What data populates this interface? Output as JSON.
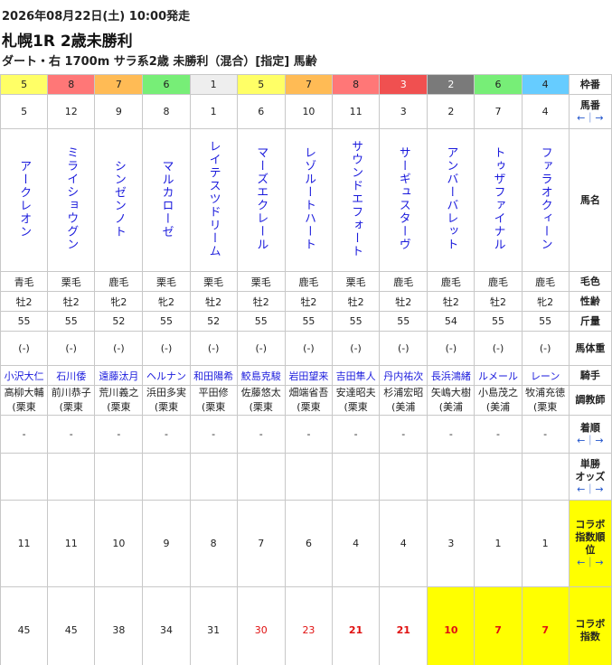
{
  "race": {
    "date_line": "2026年08月22日(土) 10:00発走",
    "title": "札幌1R 2歳未勝利",
    "info": "ダート・右 1700m サラ系2歳 未勝利（混合）[指定] 馬齢"
  },
  "labels": {
    "waku": "枠番",
    "umaban": "馬番",
    "umaban_sort": "←｜→",
    "name": "馬名",
    "coat": "毛色",
    "sex_age": "性齢",
    "weight": "斤量",
    "body_weight": "馬体重",
    "jockey": "騎手",
    "trainer": "調教師",
    "finish": "着順",
    "finish_sort": "←｜→",
    "odds_line1": "単勝",
    "odds_line2": "オッズ",
    "odds_sort": "←｜→",
    "collab_rank_l1": "コラボ",
    "collab_rank_l2": "指数順",
    "collab_rank_l3": "位",
    "collab_rank_sort": "←｜→",
    "collab_index_l1": "コラボ",
    "collab_index_l2": "指数"
  },
  "colors": {
    "waku": {
      "1": "#eeeeee",
      "2": "#7a7a7a",
      "3": "#f05050",
      "4": "#66ccff",
      "5": "#ffff66",
      "6": "#77ee77",
      "7": "#ffbb55",
      "8": "#ff7777"
    },
    "label_bg": "#ffffff",
    "highlight": "#ffff00",
    "name_blue": "#1a1adc",
    "index_red": "#e01010"
  },
  "horses": [
    {
      "waku": "5",
      "umaban": "5",
      "name": "アークレオン",
      "coat": "青毛",
      "sex_age": "牡2",
      "weight": "55",
      "body_weight": "(-)",
      "jockey": "小沢大仁",
      "trainer_name": "高柳大輔",
      "trainer_area": "(栗東",
      "finish": "-",
      "odds": "",
      "collab_rank": "11",
      "collab_index": "45",
      "idx_style": "",
      "idx_bg": ""
    },
    {
      "waku": "8",
      "umaban": "12",
      "name": "ミライショウグン",
      "coat": "栗毛",
      "sex_age": "牡2",
      "weight": "55",
      "body_weight": "(-)",
      "jockey": "石川倭",
      "trainer_name": "前川恭子",
      "trainer_area": "(栗東",
      "finish": "-",
      "odds": "",
      "collab_rank": "11",
      "collab_index": "45",
      "idx_style": "",
      "idx_bg": ""
    },
    {
      "waku": "7",
      "umaban": "9",
      "name": "シンゼンノト",
      "coat": "鹿毛",
      "sex_age": "牝2",
      "weight": "52",
      "body_weight": "(-)",
      "jockey": "遠藤汰月",
      "trainer_name": "荒川義之",
      "trainer_area": "(栗東",
      "finish": "-",
      "odds": "",
      "collab_rank": "10",
      "collab_index": "38",
      "idx_style": "",
      "idx_bg": ""
    },
    {
      "waku": "6",
      "umaban": "8",
      "name": "マルカローゼ",
      "coat": "栗毛",
      "sex_age": "牝2",
      "weight": "55",
      "body_weight": "(-)",
      "jockey": "ヘルナン",
      "trainer_name": "浜田多実",
      "trainer_area": "(栗東",
      "finish": "-",
      "odds": "",
      "collab_rank": "9",
      "collab_index": "34",
      "idx_style": "",
      "idx_bg": ""
    },
    {
      "waku": "1",
      "umaban": "1",
      "name": "レイテスツドリーム",
      "coat": "栗毛",
      "sex_age": "牡2",
      "weight": "52",
      "body_weight": "(-)",
      "jockey": "和田陽希",
      "trainer_name": "平田修",
      "trainer_area": "(栗東",
      "finish": "-",
      "odds": "",
      "collab_rank": "8",
      "collab_index": "31",
      "idx_style": "",
      "idx_bg": ""
    },
    {
      "waku": "5",
      "umaban": "6",
      "name": "マーズエクレール",
      "coat": "栗毛",
      "sex_age": "牡2",
      "weight": "55",
      "body_weight": "(-)",
      "jockey": "鮫島克駿",
      "trainer_name": "佐藤悠太",
      "trainer_area": "(栗東",
      "finish": "-",
      "odds": "",
      "collab_rank": "7",
      "collab_index": "30",
      "idx_style": "red",
      "idx_bg": ""
    },
    {
      "waku": "7",
      "umaban": "10",
      "name": "レゾルートハート",
      "coat": "鹿毛",
      "sex_age": "牡2",
      "weight": "55",
      "body_weight": "(-)",
      "jockey": "岩田望来",
      "trainer_name": "畑端省吾",
      "trainer_area": "(栗東",
      "finish": "-",
      "odds": "",
      "collab_rank": "6",
      "collab_index": "23",
      "idx_style": "red",
      "idx_bg": ""
    },
    {
      "waku": "8",
      "umaban": "11",
      "name": "サウンドエフォート",
      "coat": "栗毛",
      "sex_age": "牡2",
      "weight": "55",
      "body_weight": "(-)",
      "jockey": "吉田隼人",
      "trainer_name": "安達昭夫",
      "trainer_area": "(栗東",
      "finish": "-",
      "odds": "",
      "collab_rank": "4",
      "collab_index": "21",
      "idx_style": "redb",
      "idx_bg": ""
    },
    {
      "waku": "3",
      "umaban": "3",
      "name": "サーギュスターヴ",
      "coat": "鹿毛",
      "sex_age": "牡2",
      "weight": "55",
      "body_weight": "(-)",
      "jockey": "丹内祐次",
      "trainer_name": "杉浦宏昭",
      "trainer_area": "(美浦",
      "finish": "-",
      "odds": "",
      "collab_rank": "4",
      "collab_index": "21",
      "idx_style": "redb",
      "idx_bg": ""
    },
    {
      "waku": "2",
      "umaban": "2",
      "name": "アンバーバレット",
      "coat": "鹿毛",
      "sex_age": "牡2",
      "weight": "54",
      "body_weight": "(-)",
      "jockey": "長浜鴻緒",
      "trainer_name": "矢嶋大樹",
      "trainer_area": "(美浦",
      "finish": "-",
      "odds": "",
      "collab_rank": "3",
      "collab_index": "10",
      "idx_style": "redb",
      "idx_bg": "#ffff00"
    },
    {
      "waku": "6",
      "umaban": "7",
      "name": "トゥザファイナル",
      "coat": "鹿毛",
      "sex_age": "牡2",
      "weight": "55",
      "body_weight": "(-)",
      "jockey": "ルメール",
      "trainer_name": "小島茂之",
      "trainer_area": "(美浦",
      "finish": "-",
      "odds": "",
      "collab_rank": "1",
      "collab_index": "7",
      "idx_style": "redb",
      "idx_bg": "#ffff00"
    },
    {
      "waku": "4",
      "umaban": "4",
      "name": "ファラオクィーン",
      "coat": "鹿毛",
      "sex_age": "牝2",
      "weight": "55",
      "body_weight": "(-)",
      "jockey": "レーン",
      "trainer_name": "牧浦充徳",
      "trainer_area": "(栗東",
      "finish": "-",
      "odds": "",
      "collab_rank": "1",
      "collab_index": "7",
      "idx_style": "redb",
      "idx_bg": "#ffff00"
    }
  ]
}
